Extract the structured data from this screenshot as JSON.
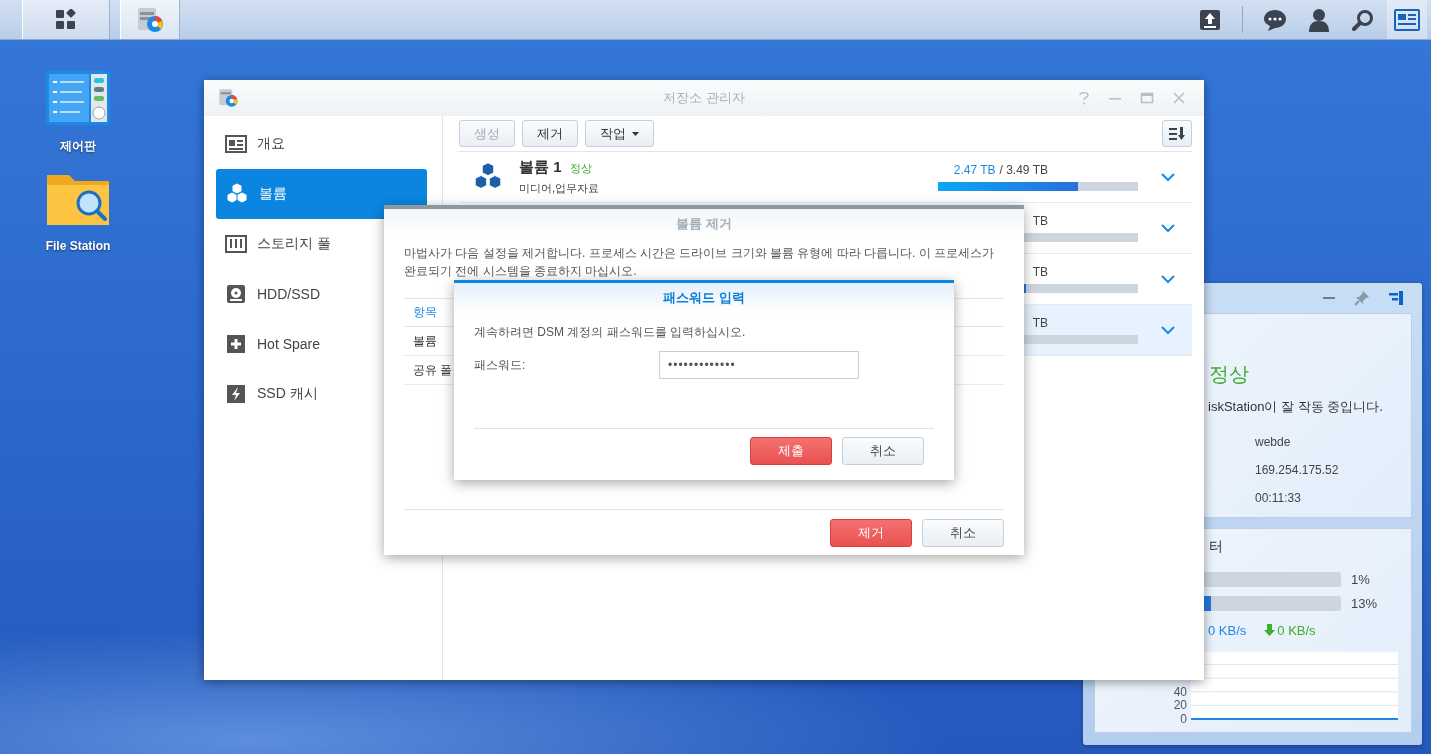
{
  "taskbar": {
    "apps": [
      {
        "kind": "main-menu",
        "selected": false
      },
      {
        "kind": "storage-manager",
        "selected": true
      }
    ],
    "tray": [
      {
        "kind": "upload",
        "selected": false
      },
      {
        "kind": "chat",
        "selected": false
      },
      {
        "kind": "user",
        "selected": false
      },
      {
        "kind": "search",
        "selected": false
      },
      {
        "kind": "widgets",
        "selected": true
      }
    ]
  },
  "desktop_icons": [
    {
      "kind": "control-panel",
      "label": "제어판"
    },
    {
      "kind": "file-station",
      "label": "File Station"
    }
  ],
  "widget_panel": {
    "health": {
      "status": "정상",
      "message": "iskStation이 잘 작동 중입니다.",
      "values": [
        "webde",
        "169.254.175.52",
        "00:11:33"
      ]
    },
    "resource_monitor": {
      "title": "터",
      "meters": [
        {
          "level": 0.01,
          "reading": "1%"
        },
        {
          "level": 0.13,
          "reading": "13%"
        }
      ],
      "upload": "0 KB/s",
      "download": "0 KB/s",
      "chart_data": {
        "type": "line",
        "ylim": [
          0,
          100
        ],
        "yticks": [
          0,
          20,
          40
        ],
        "series": [
          {
            "color": "#1e88e5",
            "values": [
              0,
              0,
              0,
              0,
              0,
              0,
              0,
              0,
              0,
              0
            ]
          }
        ]
      }
    }
  },
  "storage_manager": {
    "title": "저장소 관리자",
    "sidebar": [
      {
        "kind": "overview",
        "label": "개요",
        "selected": false
      },
      {
        "kind": "volume",
        "label": "볼륨",
        "selected": true
      },
      {
        "kind": "pool",
        "label": "스토리지 풀",
        "selected": false
      },
      {
        "kind": "hdd",
        "label": "HDD/SSD",
        "selected": false
      },
      {
        "kind": "hot-spare",
        "label": "Hot Spare",
        "selected": false
      },
      {
        "kind": "ssd-cache",
        "label": "SSD 캐시",
        "selected": false
      }
    ],
    "toolbar": [
      {
        "label": "생성",
        "disabled": true,
        "dropdown": false
      },
      {
        "label": "제거",
        "disabled": false,
        "dropdown": false
      },
      {
        "label": "작업",
        "disabled": false,
        "dropdown": true
      }
    ],
    "volumes": [
      {
        "name": "볼륨 1",
        "status": "정상",
        "description": "미디어,업무자료",
        "used": "2.47 TB",
        "total": "/ 3.49 TB",
        "level": 0.7,
        "selected": false
      },
      {
        "total": "TB",
        "selected": false
      },
      {
        "total": "TB",
        "level": 0.44,
        "selected": false
      },
      {
        "total": "TB",
        "selected": true
      }
    ]
  },
  "remove_dialog": {
    "title": "볼륨 제거",
    "message": "마법사가 다음 설정을 제거합니다. 프로세스 시간은 드라이브 크기와 볼륨 유형에 따라 다릅니다. 이 프로세스가 완료되기 전에 시스템을 종료하지 마십시오.",
    "table": {
      "columns": [
        "항목"
      ],
      "rows": [
        "볼륨",
        "공유 폴"
      ]
    },
    "buttons": [
      {
        "kind": "primary",
        "label": "제거"
      },
      {
        "kind": "secondary",
        "label": "취소"
      }
    ]
  },
  "password_dialog": {
    "title": "패스워드 입력",
    "message": "계속하려면 DSM 계정의 패스워드를 입력하십시오.",
    "field": {
      "label": "패스워드:",
      "value": "•••••••••••••"
    },
    "buttons": [
      {
        "kind": "primary",
        "label": "제출"
      },
      {
        "kind": "secondary",
        "label": "취소"
      }
    ]
  }
}
